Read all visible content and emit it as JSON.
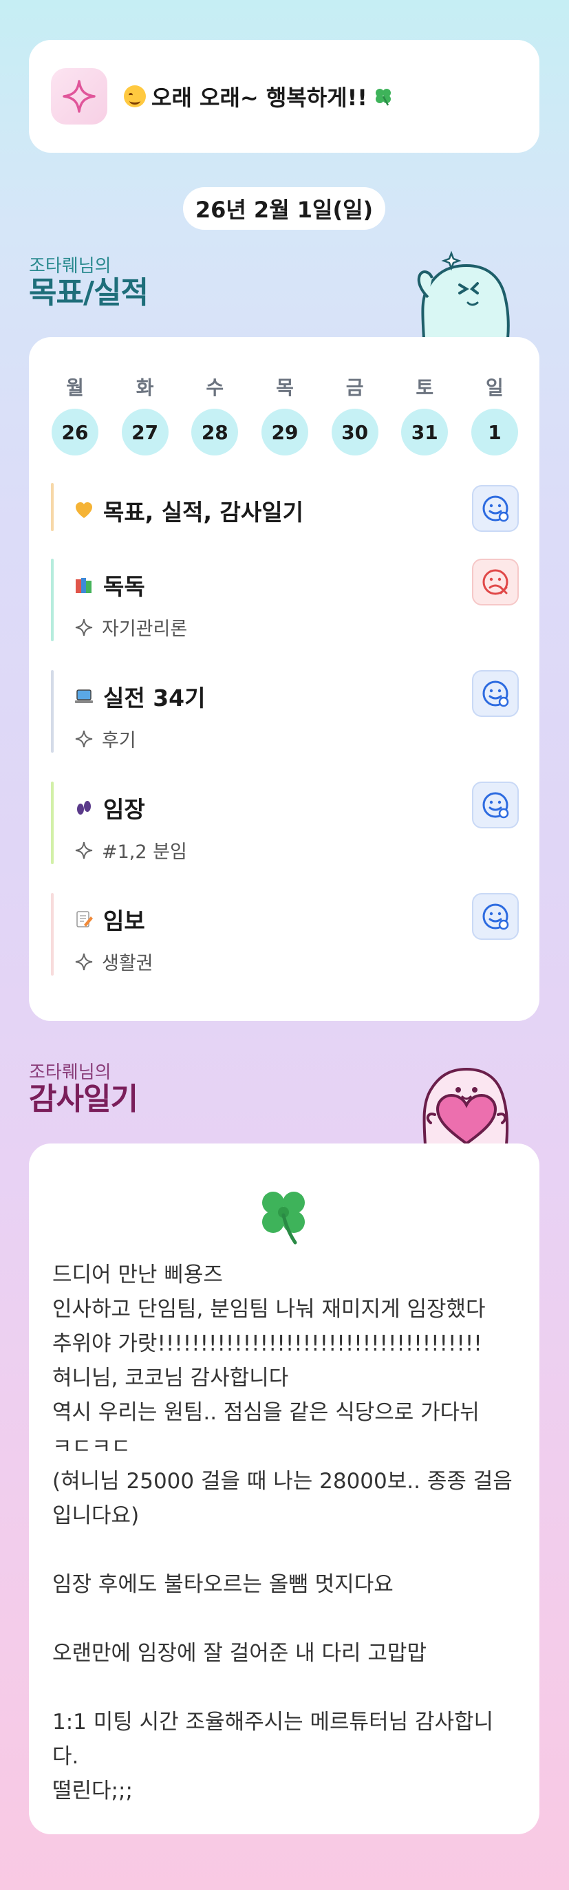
{
  "header": {
    "icon": "sparkle-icon",
    "text": "오래 오래~ 행복하게!!",
    "emoji_lead": "smile-emoji",
    "emoji_trail": "clover-emoji"
  },
  "date": "26년 2월 1일(일)",
  "goals_section": {
    "owner": "조타뤠님의",
    "title": "목표/실적"
  },
  "week": [
    {
      "day": "월",
      "num": "26"
    },
    {
      "day": "화",
      "num": "27"
    },
    {
      "day": "수",
      "num": "28"
    },
    {
      "day": "목",
      "num": "29"
    },
    {
      "day": "금",
      "num": "30"
    },
    {
      "day": "토",
      "num": "31"
    },
    {
      "day": "일",
      "num": "1"
    }
  ],
  "goals": [
    {
      "emoji": "heart-emoji",
      "title": "목표, 실적, 감사일기",
      "sub": "",
      "status": "happy",
      "color": "#f7d8a8"
    },
    {
      "emoji": "books-emoji",
      "title": "독독",
      "sub": "자기관리론",
      "status": "sad",
      "color": "#b6ecdd"
    },
    {
      "emoji": "laptop-emoji",
      "title": "실전 34기",
      "sub": "후기",
      "status": "happy",
      "color": "#d4dbe8"
    },
    {
      "emoji": "footprints-emoji",
      "title": "임장",
      "sub": "#1,2 분임",
      "status": "happy",
      "color": "#d2f0a8"
    },
    {
      "emoji": "memo-emoji",
      "title": "임보",
      "sub": "생활권",
      "status": "happy",
      "color": "#f8dcdc"
    }
  ],
  "diary_section": {
    "owner": "조타뤠님의",
    "title": "감사일기"
  },
  "diary_text": "드디어 만난 삐용즈\n인사하고 단임팀, 분임팀 나눠 재미지게 임장했다\n추위야 가랏!!!!!!!!!!!!!!!!!!!!!!!!!!!!!!!!!!!!!!\n혀니님, 코코님 감사합니다\n역시 우리는 원팀.. 점심을 같은 식당으로 가다뉘\nㅋㄷㅋㄷ\n(혀니님 25000 걸을 때 나는 28000보.. 종종 걸음\n입니다요)\n\n임장 후에도 불타오르는 올뺌 멋지다요\n\n오랜만에 임장에 잘 걸어준 내 다리 고맙맙\n\n1:1 미팅 시간 조율해주시는 메르튜터님 감사합니\n다.\n떨린다;;;"
}
